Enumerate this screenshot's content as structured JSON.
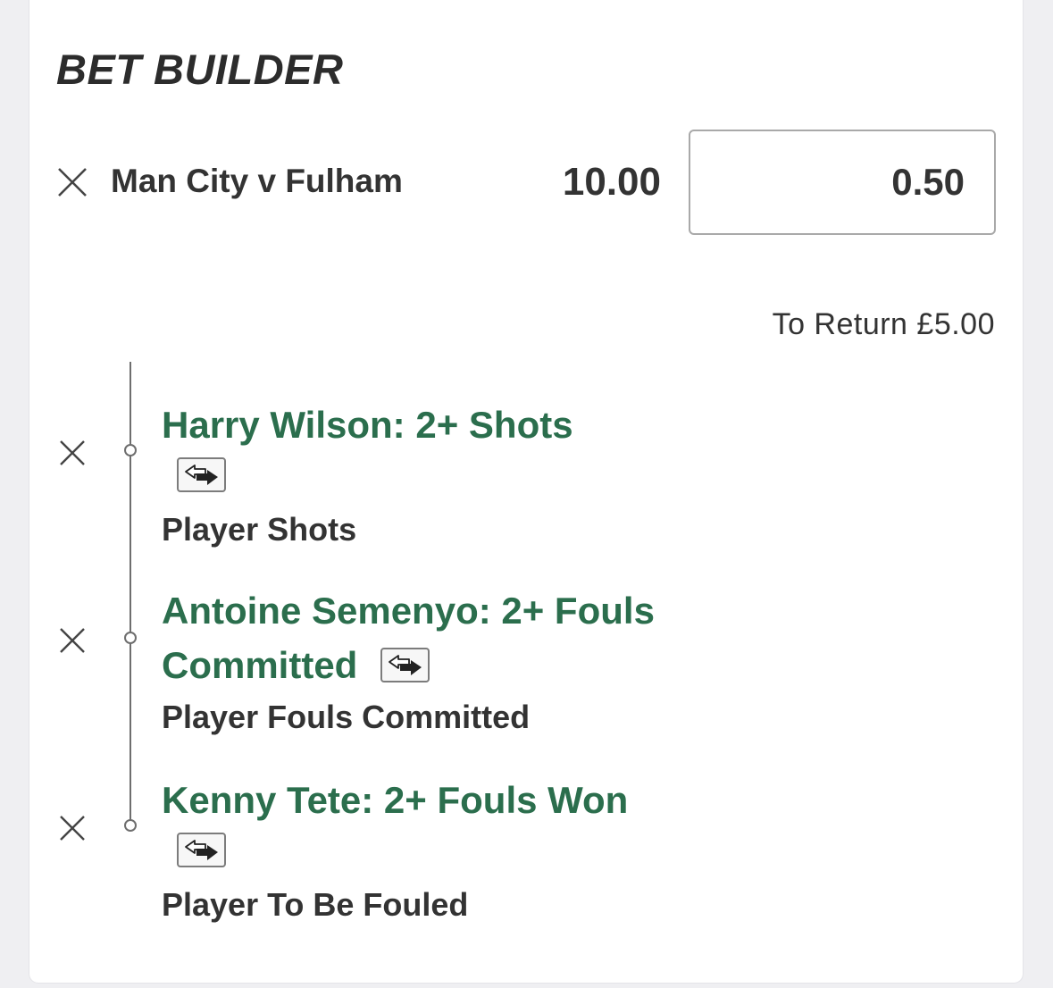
{
  "header": {
    "title": "BET BUILDER"
  },
  "bet": {
    "match": "Man City v Fulham",
    "odds": "10.00",
    "stake": "0.50",
    "to_return": "To Return £5.00"
  },
  "selections": [
    {
      "title_line1": "Harry Wilson: 2+ Shots",
      "market": "Player Shots",
      "icon": "swap-icon"
    },
    {
      "title_line1": "Antoine Semenyo: 2+ Fouls",
      "title_line2": "Committed",
      "market": "Player Fouls Committed",
      "icon": "swap-icon"
    },
    {
      "title_line1": "Kenny Tete: 2+ Fouls Won",
      "market": "Player To Be Fouled",
      "icon": "swap-icon"
    }
  ],
  "colors": {
    "selection_green": "#2b6e4d",
    "text_dark": "#333333",
    "background": "#efeff2"
  }
}
